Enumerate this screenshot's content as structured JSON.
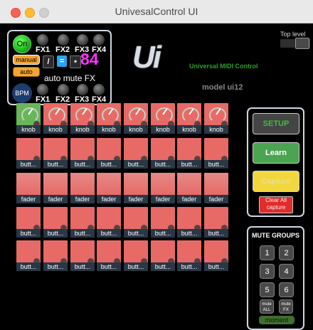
{
  "window": {
    "title": "UnivesalControl UI"
  },
  "top": {
    "on_label": "On",
    "fx_labels_top": [
      "FX1",
      "FX2",
      "FX3",
      "FX4"
    ],
    "fx_labels_bottom": [
      "FX1",
      "FX2",
      "FX3",
      "FX4"
    ],
    "manual_label": "manual",
    "auto_label": "auto",
    "tool_symbols": [
      "/",
      "=",
      "•"
    ],
    "number": "84",
    "auto_mute_label": "auto mute FX",
    "bpm_label": "BPM"
  },
  "brand": {
    "logo": "Ui",
    "name": "Universal MIDI Control",
    "model": "model ui12"
  },
  "top_level": {
    "label": "Top level"
  },
  "grid": {
    "rows": [
      {
        "type": "knob",
        "label": "knob",
        "count": 8
      },
      {
        "type": "button",
        "label": "butt...",
        "count": 8
      },
      {
        "type": "fader",
        "label": "fader",
        "count": 8
      },
      {
        "type": "button",
        "label": "butt...",
        "count": 8
      },
      {
        "type": "button",
        "label": "butt...",
        "count": 8
      }
    ]
  },
  "controls": {
    "setup_label": "SETUP",
    "learn_label": "Learn",
    "capture_label": "Capture",
    "clear_label": "Clear All capture"
  },
  "mute_groups": {
    "title": "MUTE GROUPS",
    "buttons": [
      "1",
      "2",
      "3",
      "4",
      "5",
      "6"
    ],
    "mute_all": "mute ALL",
    "mute_fx": "mute FX",
    "moment": "moment"
  },
  "colors": {
    "accent_pink": "#ff34ff",
    "cell_red": "#e86a66",
    "cell_green": "#69b659"
  }
}
